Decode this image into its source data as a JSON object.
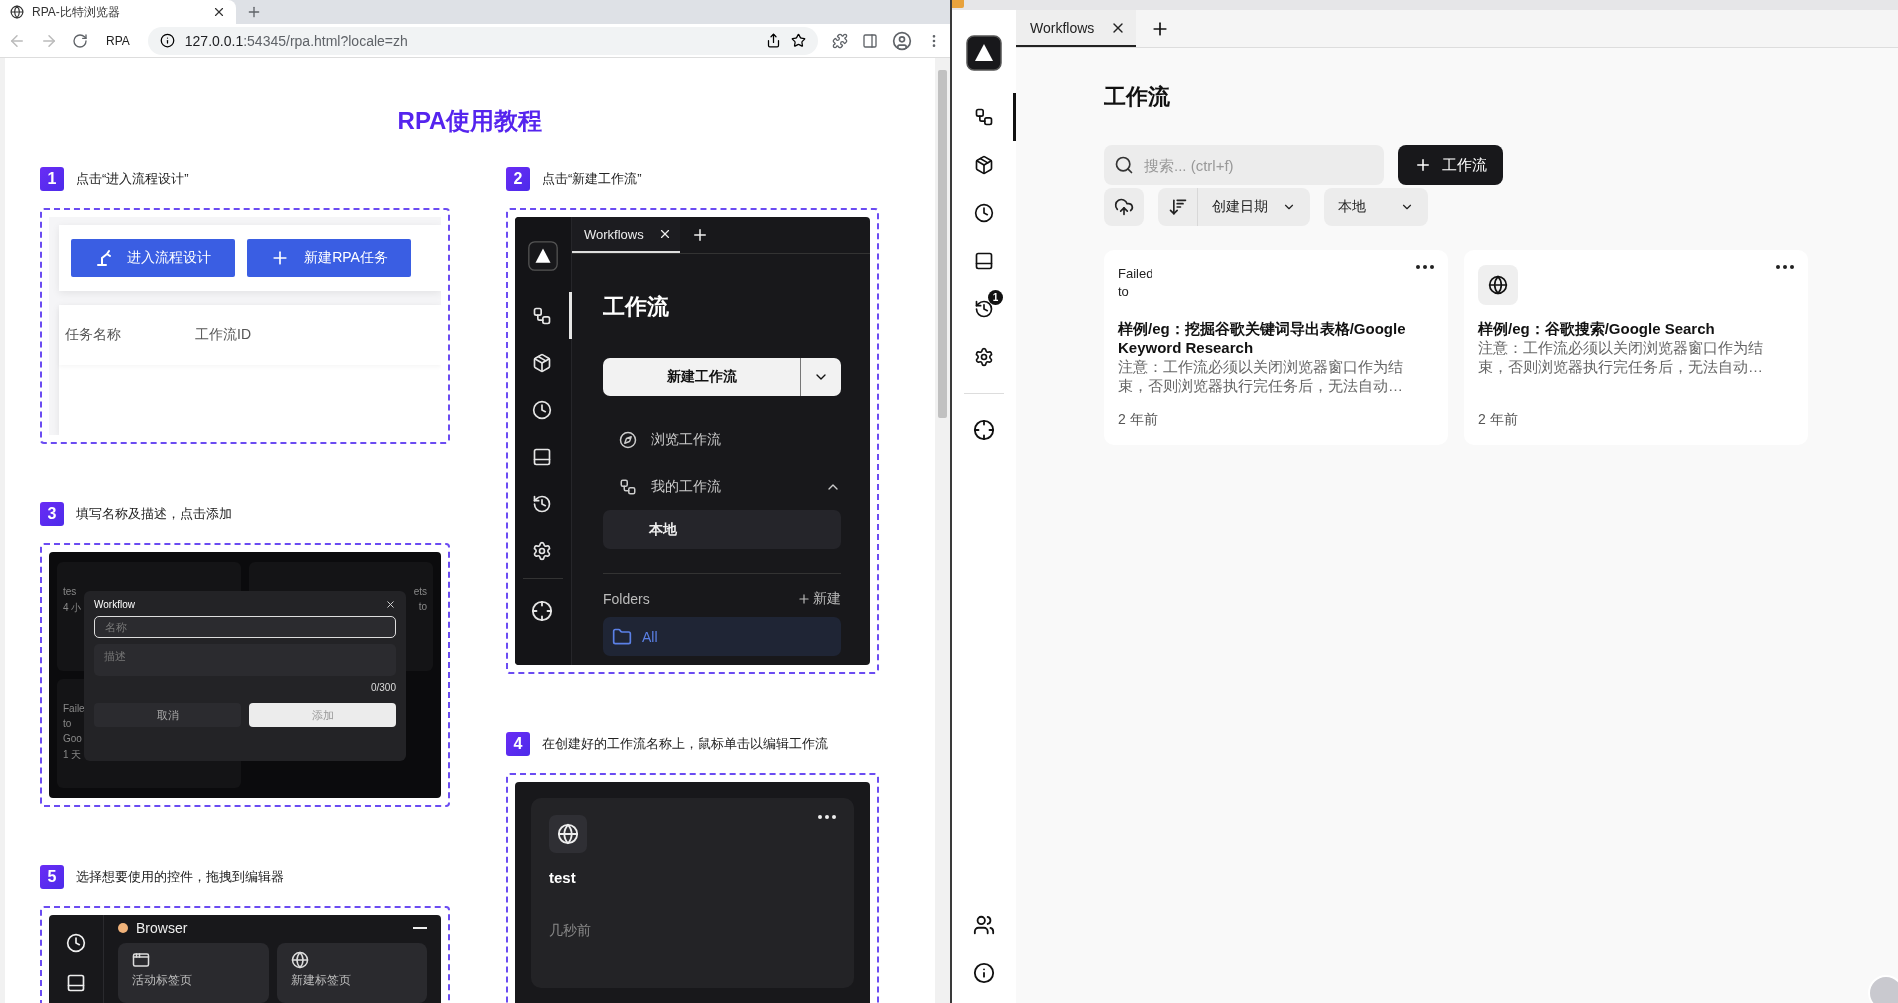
{
  "browser": {
    "tab": {
      "title": "RPA-比特浏览器"
    },
    "toolbar": {
      "extension_label": "RPA"
    },
    "address_bar": {
      "host": "127.0.0.1",
      "path": ":54345/rpa.html?locale=zh"
    }
  },
  "tutorial": {
    "title": "RPA使用教程",
    "columns": [
      [
        {
          "kind": "task_list",
          "number": "1",
          "caption": "点击“进入流程设计”",
          "buttons": [
            "进入流程设计",
            "新建RPA任务"
          ],
          "table_columns": [
            "任务名称",
            "工作流ID"
          ]
        },
        {
          "kind": "dialog",
          "number": "3",
          "caption": "填写名称及描述，点击添加",
          "background_cards": [
            [
              "tes",
              "4 小"
            ],
            [
              "ets",
              "to"
            ],
            [
              "Faile",
              "to",
              "Goo",
              "1 天"
            ]
          ],
          "dialog": {
            "title": "Workflow",
            "name_placeholder": "名称",
            "description_placeholder": "描述",
            "counter": "0/300",
            "cancel": "取消",
            "confirm": "添加"
          }
        },
        {
          "kind": "blocks",
          "number": "5",
          "caption": "选择想要使用的控件，拖拽到编辑器",
          "group": {
            "title": "Browser",
            "blocks": [
              {
                "kind": "tab",
                "label": "活动标签页"
              },
              {
                "kind": "globe",
                "label": "新建标签页"
              }
            ]
          }
        }
      ],
      [
        {
          "kind": "workflow_sidebar",
          "number": "2",
          "caption": "点击“新建工作流”",
          "tab": "Workflows",
          "sidebar": [
            {
              "kind": "workflows",
              "selected": true
            },
            {
              "kind": "packages",
              "selected": false
            },
            {
              "kind": "schedule",
              "selected": false
            },
            {
              "kind": "storage",
              "selected": false
            },
            {
              "kind": "history",
              "selected": false
            },
            {
              "kind": "settings",
              "selected": false
            },
            {
              "kind": "target",
              "selected": false
            }
          ],
          "heading": "工作流",
          "new_button": "新建工作流",
          "nav": [
            {
              "kind": "browse",
              "label": "浏览工作流"
            },
            {
              "kind": "mine",
              "label": "我的工作流",
              "expanded": true
            }
          ],
          "sub_item": "本地",
          "folders_title": "Folders",
          "folders_new": "新建",
          "folders": [
            {
              "label": "All",
              "selected": true
            }
          ]
        },
        {
          "kind": "workflow_card",
          "number": "4",
          "caption": "在创建好的工作流名称上，鼠标单击以编辑工作流",
          "card": {
            "title": "test",
            "time": "几秒前"
          }
        }
      ]
    ]
  },
  "app": {
    "tab": {
      "label": "Workflows"
    },
    "sidebar": {
      "items": [
        {
          "kind": "workflows",
          "selected": true
        },
        {
          "kind": "packages",
          "selected": false
        },
        {
          "kind": "schedule",
          "selected": false
        },
        {
          "kind": "storage",
          "selected": false
        },
        {
          "kind": "history",
          "selected": false,
          "badge": "1"
        },
        {
          "kind": "settings",
          "selected": false
        }
      ],
      "tools": [
        {
          "kind": "target",
          "selected": false
        }
      ],
      "footer": [
        {
          "kind": "team",
          "selected": false
        },
        {
          "kind": "about",
          "selected": false
        }
      ]
    },
    "title": "工作流",
    "search": {
      "placeholder": "搜索... (ctrl+f)"
    },
    "new_button": "工作流",
    "sort": {
      "label": "创建日期"
    },
    "filter": {
      "label": "本地"
    },
    "workflows": [
      {
        "kind": "image",
        "icon_text": "Failed to",
        "title": "样例/eg：挖掘谷歌关键词导出表格/Google Keyword Research",
        "description": "注意：工作流必须以关闭浏览器窗口作为结束，否则浏览器执行完任务后，无法自动…",
        "time": "2 年前"
      },
      {
        "kind": "globe",
        "title": "样例/eg：谷歌搜索/Google Search",
        "description": "注意：工作流必须以关闭浏览器窗口作为结束，否则浏览器执行完任务后，无法自动…",
        "time": "2 年前"
      }
    ]
  }
}
